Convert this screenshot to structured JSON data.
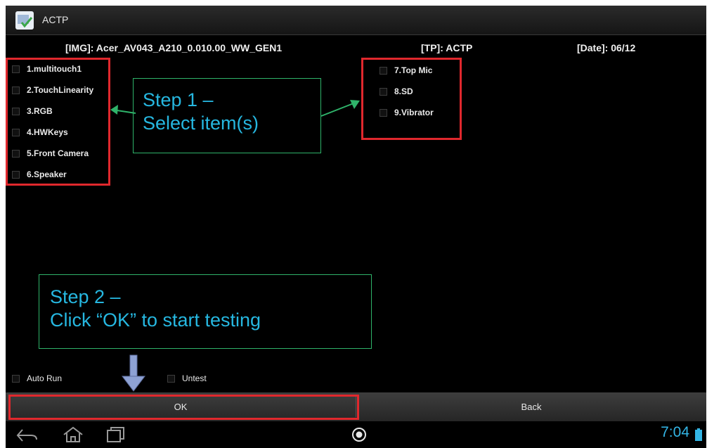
{
  "app": {
    "title": "ACTP",
    "icon": "actp-app-icon"
  },
  "info": {
    "img": "[IMG]: Acer_AV043_A210_0.010.00_WW_GEN1",
    "tp": "[TP]: ACTP",
    "date": "[Date]: 06/12"
  },
  "left_items": [
    {
      "label": "1.multitouch1",
      "checked": false
    },
    {
      "label": "2.TouchLinearity",
      "checked": false
    },
    {
      "label": "3.RGB",
      "checked": false
    },
    {
      "label": "4.HWKeys",
      "checked": false
    },
    {
      "label": "5.Front Camera",
      "checked": false
    },
    {
      "label": "6.Speaker",
      "checked": false
    }
  ],
  "right_items": [
    {
      "label": "7.Top Mic",
      "checked": false
    },
    {
      "label": "8.SD",
      "checked": false
    },
    {
      "label": "9.Vibrator",
      "checked": false
    }
  ],
  "options": {
    "auto_run": {
      "label": "Auto Run",
      "checked": false
    },
    "untest": {
      "label": "Untest",
      "checked": false
    }
  },
  "callouts": {
    "step1": {
      "line1": "Step 1 –",
      "line2": "Select item(s)"
    },
    "step2": {
      "line1": "Step 2 –",
      "line2": "Click “OK” to start testing"
    }
  },
  "buttons": {
    "ok": "OK",
    "back": "Back"
  },
  "navbar": {
    "icons": [
      "back-icon",
      "home-icon",
      "recent-apps-icon",
      "notification-circle-icon",
      "battery-icon"
    ],
    "clock": "7:04"
  },
  "colors": {
    "highlight_red": "#e0282d",
    "callout_border": "#2fb36a",
    "callout_text": "#26b7e0",
    "arrow": "#7f93c4",
    "clock": "#33b5e5"
  }
}
